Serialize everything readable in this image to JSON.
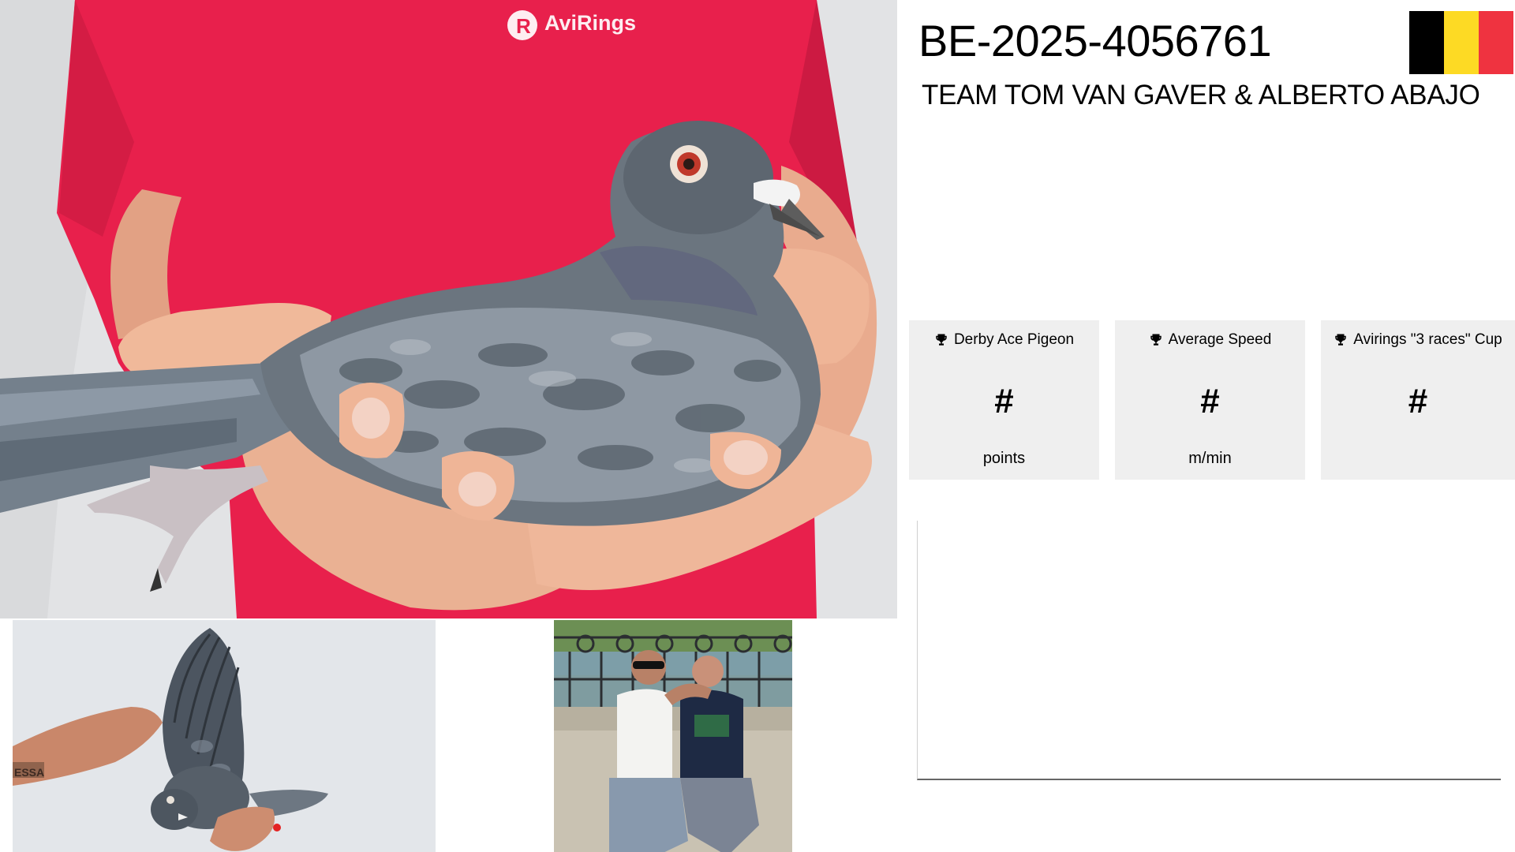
{
  "brand": {
    "shirt_logo": "AviRings"
  },
  "pigeon": {
    "ring_number": "BE-2025-4056761",
    "owner": "TEAM TOM VAN GAVER & ALBERTO ABAJO",
    "country_flag_colors": [
      "#000000",
      "#fdda24",
      "#ef3340"
    ]
  },
  "stats": [
    {
      "title": "Derby Ace Pigeon",
      "icon": "trophy-icon",
      "value": "#",
      "unit": "points"
    },
    {
      "title": "Average Speed",
      "icon": "trophy-icon",
      "value": "#",
      "unit": "m/min"
    },
    {
      "title": "Avirings \"3 races\" Cup",
      "icon": "trophy-icon",
      "value": "#",
      "unit": ""
    }
  ],
  "photos": {
    "main": "pigeon-held-photo",
    "thumb_1": "wing-spread-photo",
    "thumb_2": "team-photo"
  }
}
